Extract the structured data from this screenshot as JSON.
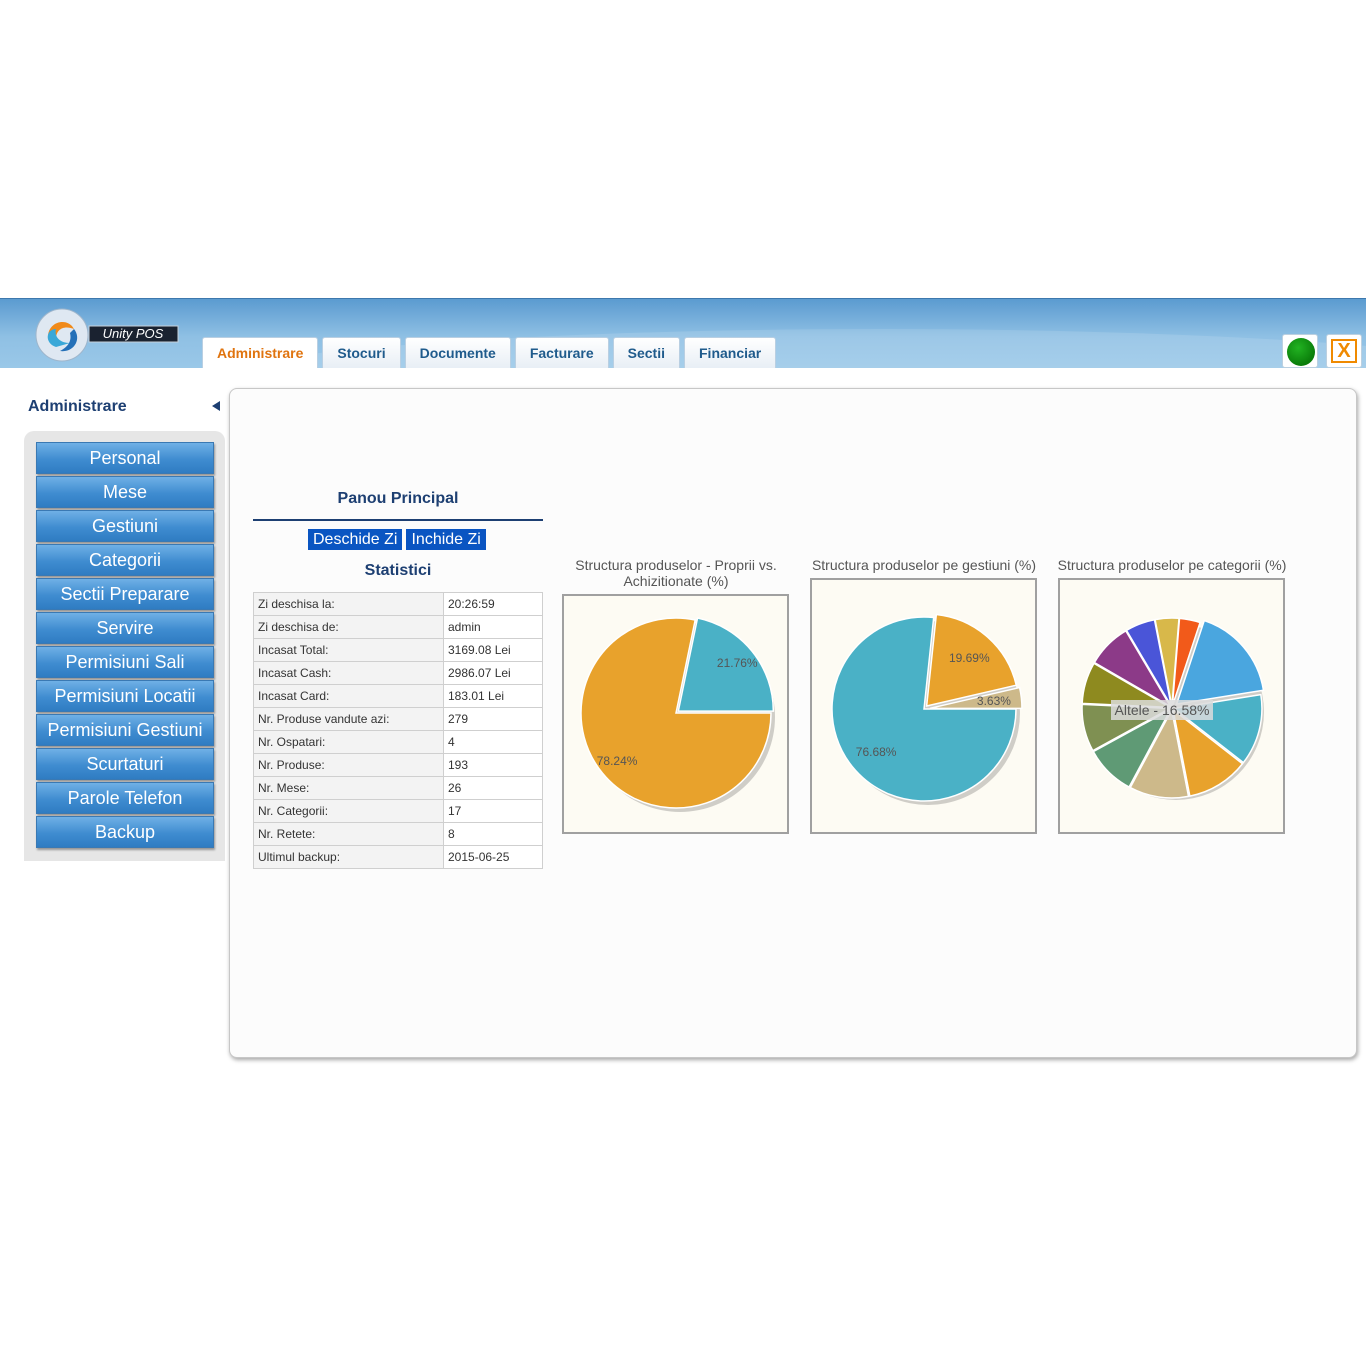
{
  "header": {
    "logo_text": "Unity POS",
    "tabs": [
      {
        "label": "Administrare",
        "active": true
      },
      {
        "label": "Stocuri",
        "active": false
      },
      {
        "label": "Documente",
        "active": false
      },
      {
        "label": "Facturare",
        "active": false
      },
      {
        "label": "Sectii",
        "active": false
      },
      {
        "label": "Financiar",
        "active": false
      }
    ],
    "status_icon": "green-status-dot",
    "close_label": "X",
    "colors": {
      "accent": "#e0740f",
      "tab_text": "#1f5b8c",
      "status": "#13a013",
      "close": "#f08a00"
    }
  },
  "sidebar": {
    "title": "Administrare",
    "items": [
      {
        "label": "Personal"
      },
      {
        "label": "Mese"
      },
      {
        "label": "Gestiuni"
      },
      {
        "label": "Categorii"
      },
      {
        "label": "Sectii Preparare"
      },
      {
        "label": "Servire"
      },
      {
        "label": "Permisiuni Sali"
      },
      {
        "label": "Permisiuni Locatii"
      },
      {
        "label": "Permisiuni Gestiuni"
      },
      {
        "label": "Scurtaturi"
      },
      {
        "label": "Parole Telefon"
      },
      {
        "label": "Backup"
      }
    ]
  },
  "main": {
    "title": "Panou Principal",
    "open_day_label": "Deschide Zi",
    "close_day_label": "Inchide Zi",
    "stats_title": "Statistici",
    "stats": [
      {
        "label": "Zi deschisa la:",
        "value": "20:26:59"
      },
      {
        "label": "Zi deschisa de:",
        "value": "admin"
      },
      {
        "label": "Incasat Total:",
        "value": "3169.08 Lei"
      },
      {
        "label": "Incasat Cash:",
        "value": "2986.07 Lei"
      },
      {
        "label": "Incasat Card:",
        "value": "183.01 Lei"
      },
      {
        "label": "Nr. Produse vandute azi:",
        "value": "279"
      },
      {
        "label": "Nr. Ospatari:",
        "value": "4"
      },
      {
        "label": "Nr. Produse:",
        "value": "193"
      },
      {
        "label": "Nr. Mese:",
        "value": "26"
      },
      {
        "label": "Nr. Categorii:",
        "value": "17"
      },
      {
        "label": "Nr. Retete:",
        "value": "8"
      },
      {
        "label": "Ultimul backup:",
        "value": "2015-06-25"
      }
    ]
  },
  "chart_data": [
    {
      "type": "pie",
      "title_line1": "Structura produselor - Proprii vs.",
      "title_line2": "Achizitionate (%)",
      "slices": [
        {
          "value": 78.24,
          "label": "78.24%",
          "color": "#e8a22c"
        },
        {
          "value": 21.76,
          "label": "21.76%",
          "color": "#4ab1c6"
        }
      ]
    },
    {
      "type": "pie",
      "title": "Structura produselor pe gestiuni (%)",
      "slices": [
        {
          "value": 76.68,
          "label": "76.68%",
          "color": "#4ab1c6"
        },
        {
          "value": 19.69,
          "label": "19.69%",
          "color": "#e8a22c"
        },
        {
          "value": 3.63,
          "label": "3.63%",
          "color": "#cdb98a"
        }
      ]
    },
    {
      "type": "pie",
      "title": "Structura produselor pe categorii (%)",
      "slices": [
        {
          "value": 16.0,
          "color": "#4aa6df"
        },
        {
          "value": 12.0,
          "color": "#4ab1c6"
        },
        {
          "value": 10.5,
          "color": "#e8a22c"
        },
        {
          "value": 10.0,
          "color": "#cdb98a"
        },
        {
          "value": 8.5,
          "color": "#5f9a75"
        },
        {
          "value": 8.0,
          "color": "#7f9052"
        },
        {
          "value": 7.0,
          "color": "#8e8a1f"
        },
        {
          "value": 7.5,
          "color": "#8c3a88"
        },
        {
          "value": 5.0,
          "color": "#4a55d8"
        },
        {
          "value": 4.0,
          "color": "#d8b84a"
        },
        {
          "value": 3.5,
          "color": "#f25a1a"
        }
      ],
      "hover_label": "Altele - 16.58%"
    }
  ]
}
